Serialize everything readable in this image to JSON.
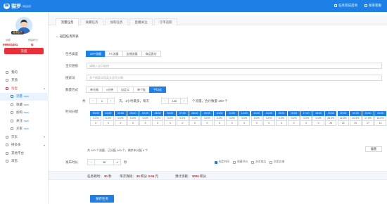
{
  "topbar": {
    "logo_mark": "猫",
    "logo_text": "猫罗",
    "logo_sub": "网店运营",
    "links": [
      "任务完成咨询",
      "联系客服"
    ]
  },
  "user": {
    "badge": "普通会员",
    "uid": "ID4",
    "labels": [
      "余额",
      "佣金积分"
    ],
    "values": [
      "9990/3491",
      "N"
    ],
    "recharge": "充值"
  },
  "nav": [
    {
      "label": "我的",
      "state": ""
    },
    {
      "label": "充值",
      "state": ""
    },
    {
      "label": "淘宝",
      "state": "open"
    },
    {
      "label": "流量",
      "state": "active",
      "sub": true,
      "tag": "NEW"
    },
    {
      "label": "收藏",
      "state": "",
      "sub": true,
      "tag": "NEW"
    },
    {
      "label": "加购",
      "state": "",
      "sub": true,
      "tag": "NEW"
    },
    {
      "label": "关注",
      "state": "",
      "sub": true,
      "tag": "NEW"
    },
    {
      "label": "买家",
      "state": "",
      "sub": true,
      "tag": "NEW"
    },
    {
      "label": "京东",
      "state": ""
    },
    {
      "label": "拼多多",
      "state": ""
    },
    {
      "label": "其他平台",
      "state": ""
    },
    {
      "label": "日志",
      "state": ""
    }
  ],
  "tabs": [
    "流量任务",
    "收藏任务",
    "加购任务",
    "直播关注",
    "订单追踪"
  ],
  "back": "返回任务列表",
  "form": {
    "task_type_label": "任务类型",
    "task_types": [
      "APP流量",
      "PC流量",
      "店铺流量",
      "商品直访"
    ],
    "link_label": "宝贝链接",
    "link_placeholder": "请输入宝贝链接",
    "keyword_label": "搜索词",
    "keyword_placeholder": "多个搜索词用英文逗号分隔",
    "count_label": "数量方式",
    "count_modes": [
      "单元格",
      "x分钟",
      "自定义",
      "单个批",
      "平均化"
    ],
    "row_prefix": "共",
    "qty": "1",
    "row_mid": "天，1小时最多，每天",
    "qty2": "100",
    "row_suffix": "个流量，合计数量 100 个",
    "hours_label": "时间分配"
  },
  "hours": [
    {
      "h": "00:00",
      "p": "0.0%",
      "v": "0"
    },
    {
      "h": "01:00",
      "p": "0.0%",
      "v": "0"
    },
    {
      "h": "02:00",
      "p": "0.0%",
      "v": "0"
    },
    {
      "h": "03:00",
      "p": "0.0%",
      "v": "0"
    },
    {
      "h": "04:00",
      "p": "0.0%",
      "v": "0"
    },
    {
      "h": "05:00",
      "p": "0.0%",
      "v": "0"
    },
    {
      "h": "06:00",
      "p": "0.0%",
      "v": "0"
    },
    {
      "h": "07:00",
      "p": "0.0%",
      "v": "0"
    },
    {
      "h": "08:00",
      "p": "0.0%",
      "v": "0"
    },
    {
      "h": "09:00",
      "p": "0.0%",
      "v": "0"
    },
    {
      "h": "10:00",
      "p": "0.0%",
      "v": "0"
    },
    {
      "h": "11:00",
      "p": "0.0%",
      "v": "0"
    },
    {
      "h": "12:00",
      "p": "0.0%",
      "v": "0"
    },
    {
      "h": "13:00",
      "p": "0.0%",
      "v": "0"
    },
    {
      "h": "14:00",
      "p": "0.0%",
      "v": "0"
    },
    {
      "h": "15:00",
      "p": "0.0%",
      "v": "0"
    },
    {
      "h": "16:00",
      "p": "0.0%",
      "v": "0"
    },
    {
      "h": "17:00",
      "p": "0.0%",
      "v": "0"
    },
    {
      "h": "18:00",
      "p": "0.0%",
      "v": "0"
    },
    {
      "h": "19:00",
      "p": "26.0%",
      "v": "26"
    },
    {
      "h": "20:00",
      "p": "22.0%",
      "v": "22"
    },
    {
      "h": "21:00",
      "p": "20.0%",
      "v": "20"
    },
    {
      "h": "22:00",
      "p": "17.0%",
      "v": "17"
    },
    {
      "h": "23:00",
      "p": "14.0%",
      "v": "14"
    }
  ],
  "note_text": "共 100 个流量，已分配 100 个，剩余未分配 0 个",
  "reset": "重置",
  "interval": {
    "label": "发布时长",
    "value": "30",
    "unit": "秒"
  },
  "options": [
    "指定时间",
    "隐藏评价",
    "浏览商品",
    "浏览店铺"
  ],
  "summary": {
    "a_label": "任务耗时：",
    "a_val": "30",
    "a_unit": "秒",
    "b_label": "单次消耗：",
    "b_val": "30",
    "b_mid": "积分",
    "b_val2": "0.06",
    "b_unit": "元",
    "c_label": "预计消耗：",
    "c_val": "3000",
    "c_unit": "积分"
  },
  "submit": "保存任务",
  "colors": {
    "accent": "#1e7fe6",
    "danger": "#e9303a"
  }
}
